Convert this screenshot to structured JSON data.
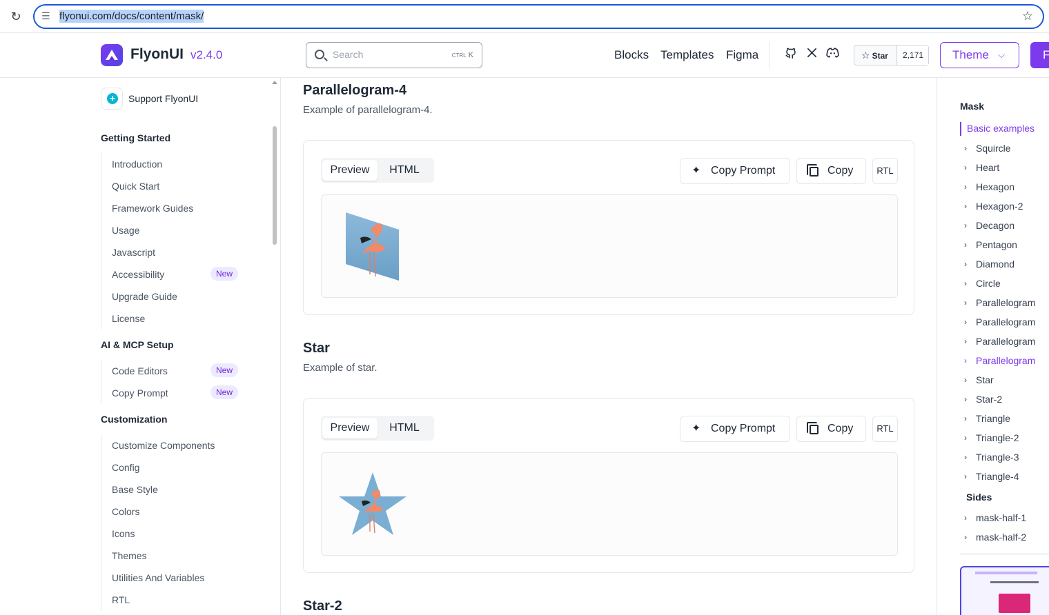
{
  "browser": {
    "url": "flyonui.com/docs/content/mask/"
  },
  "header": {
    "brand": "FlyonUI",
    "version": "v2.4.0",
    "search_placeholder": "Search",
    "search_kbd_ctrl": "CTRL",
    "search_kbd_key": "K",
    "nav": [
      "Blocks",
      "Templates",
      "Figma"
    ],
    "star_label": "Star",
    "star_count": "2,171",
    "theme_label": "Theme",
    "cta_label": "F"
  },
  "sidebar": {
    "support": "Support FlyonUI",
    "sections": [
      {
        "title": "Getting Started",
        "items": [
          {
            "label": "Introduction",
            "badge": ""
          },
          {
            "label": "Quick Start",
            "badge": ""
          },
          {
            "label": "Framework Guides",
            "badge": ""
          },
          {
            "label": "Usage",
            "badge": ""
          },
          {
            "label": "Javascript",
            "badge": ""
          },
          {
            "label": "Accessibility",
            "badge": "New"
          },
          {
            "label": "Upgrade Guide",
            "badge": ""
          },
          {
            "label": "License",
            "badge": ""
          }
        ]
      },
      {
        "title": "AI & MCP Setup",
        "items": [
          {
            "label": "Code Editors",
            "badge": "New"
          },
          {
            "label": "Copy Prompt",
            "badge": "New"
          }
        ]
      },
      {
        "title": "Customization",
        "items": [
          {
            "label": "Customize Components",
            "badge": ""
          },
          {
            "label": "Config",
            "badge": ""
          },
          {
            "label": "Base Style",
            "badge": ""
          },
          {
            "label": "Colors",
            "badge": ""
          },
          {
            "label": "Icons",
            "badge": ""
          },
          {
            "label": "Themes",
            "badge": ""
          },
          {
            "label": "Utilities And Variables",
            "badge": ""
          },
          {
            "label": "RTL",
            "badge": ""
          }
        ]
      }
    ]
  },
  "main": {
    "examples": [
      {
        "title": "Parallelogram-4",
        "desc": "Example of parallelogram-4.",
        "shape": "parallelogram-4"
      },
      {
        "title": "Star",
        "desc": "Example of star.",
        "shape": "star"
      },
      {
        "title": "Star-2",
        "desc": "",
        "shape": "star-2"
      }
    ],
    "tab_preview": "Preview",
    "tab_html": "HTML",
    "copy_prompt": "Copy Prompt",
    "copy": "Copy",
    "rtl": "RTL"
  },
  "toc": {
    "heading": "Mask",
    "group": "Basic examples",
    "items": [
      "Squircle",
      "Heart",
      "Hexagon",
      "Hexagon-2",
      "Decagon",
      "Pentagon",
      "Diamond",
      "Circle",
      "Parallelogram",
      "Parallelogram",
      "Parallelogram",
      "Parallelogram",
      "Star",
      "Star-2",
      "Triangle",
      "Triangle-2",
      "Triangle-3",
      "Triangle-4"
    ],
    "active_index": 11,
    "sides_heading": "Sides",
    "sides_items": [
      "mask-half-1",
      "mask-half-2"
    ]
  },
  "colors": {
    "accent": "#7c3aed",
    "image_sky": "#7aaed3",
    "flamingo": "#f08a6a"
  }
}
